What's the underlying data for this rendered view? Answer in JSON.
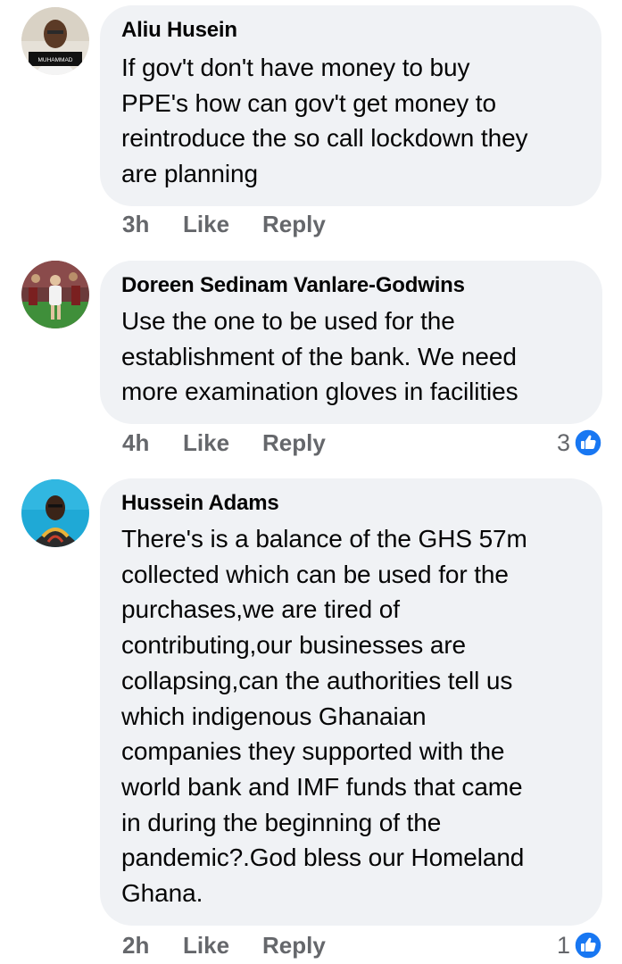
{
  "comments": [
    {
      "author": "Aliu Husein",
      "avatar_caption": "MUHAMMAD",
      "lines": [
        "If gov't don't have money to buy",
        "PPE's how can gov't get money to",
        "reintroduce the so call lockdown they",
        "are planning"
      ],
      "time": "3h",
      "like_label": "Like",
      "reply_label": "Reply",
      "reaction_count": ""
    },
    {
      "author": "Doreen Sedinam Vanlare-Godwins",
      "lines": [
        "Use the one to be used for the",
        "establishment of the bank. We need",
        "more examination gloves in facilities"
      ],
      "time": "4h",
      "like_label": "Like",
      "reply_label": "Reply",
      "reaction_count": "3"
    },
    {
      "author": "Hussein Adams",
      "lines": [
        "There's is a balance of the GHS 57m",
        "collected which can be used for the",
        "purchases,we are tired of",
        "contributing,our businesses are",
        "collapsing,can the authorities tell us",
        "which indigenous Ghanaian",
        "companies they supported with the",
        "world bank and IMF funds that came",
        "in during the beginning of the",
        "pandemic?.God bless our Homeland",
        "Ghana."
      ],
      "time": "2h",
      "like_label": "Like",
      "reply_label": "Reply",
      "reaction_count": "1"
    }
  ],
  "colors": {
    "bubble": "#f0f2f5",
    "secondary_text": "#65676b",
    "like_blue": "#1877f2"
  },
  "icons": {
    "reaction": "like-thumb-icon"
  }
}
